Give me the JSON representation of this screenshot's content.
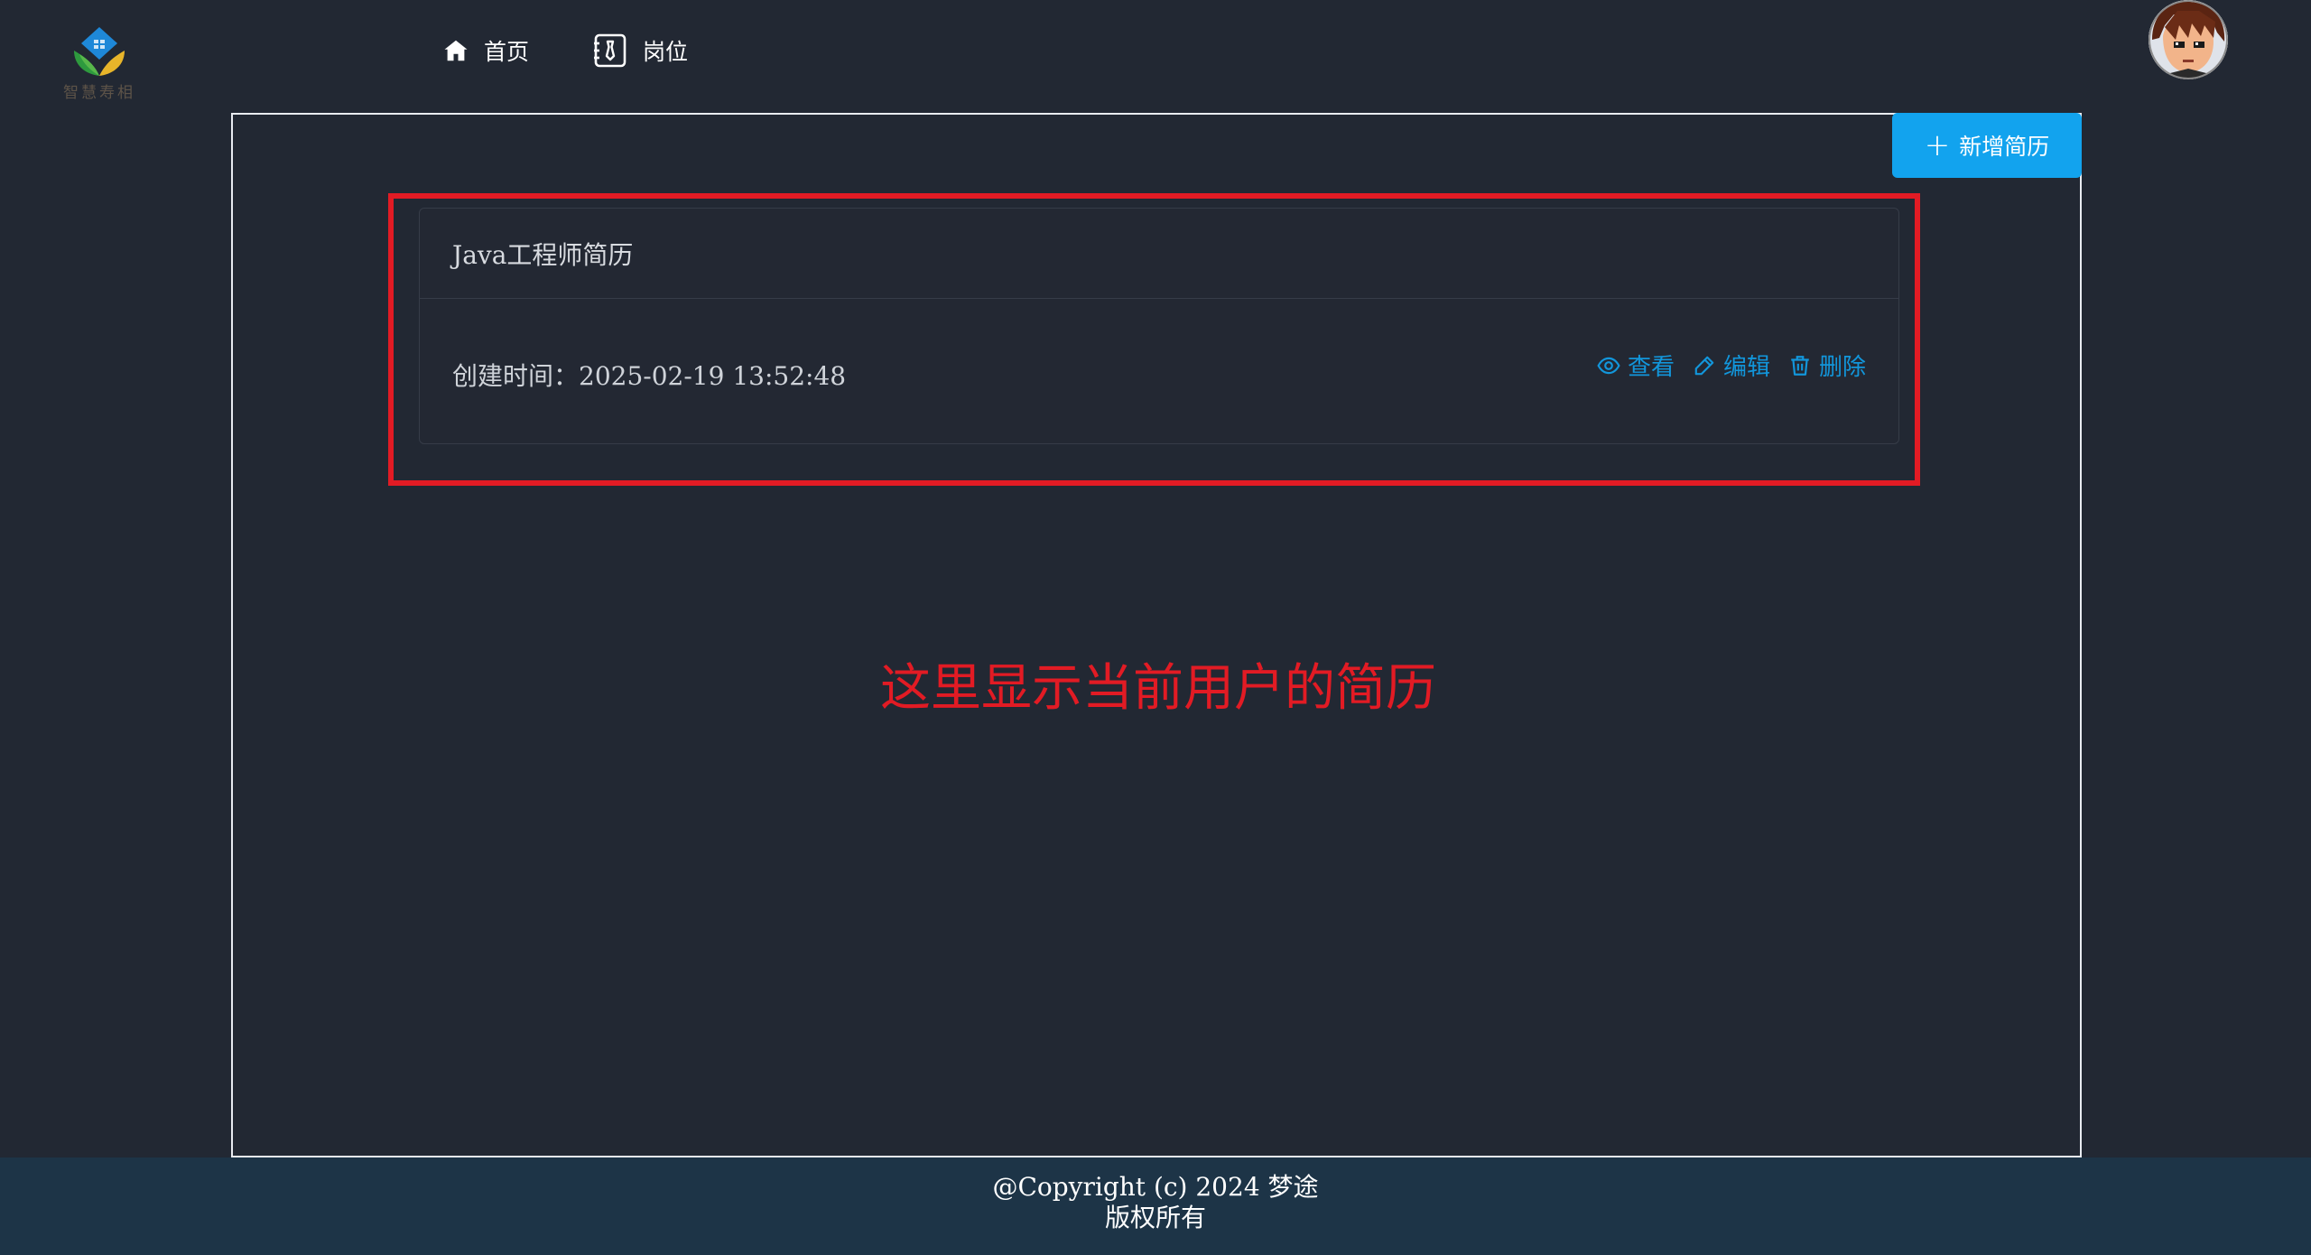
{
  "header": {
    "logo_caption": "智慧寿相",
    "nav": [
      {
        "label": "首页",
        "icon": "home-icon"
      },
      {
        "label": "岗位",
        "icon": "briefcase-icon"
      }
    ],
    "avatar_icon": "user-avatar"
  },
  "main": {
    "add_button_label": "新增简历",
    "resume": {
      "title": "Java工程师简历",
      "created": "创建时间：2025-02-19 13:52:48",
      "actions": {
        "view": "查看",
        "edit": "编辑",
        "delete": "删除"
      }
    },
    "annotation": "这里显示当前用户的简历"
  },
  "footer": {
    "line1": "@Copyright (c) 2024 梦途",
    "line2": "版权所有"
  },
  "colors": {
    "background": "#222833",
    "accent": "#12a3ee",
    "link": "#1296db",
    "annotation_red": "#e21b24",
    "footer_bg": "#1d3447"
  }
}
